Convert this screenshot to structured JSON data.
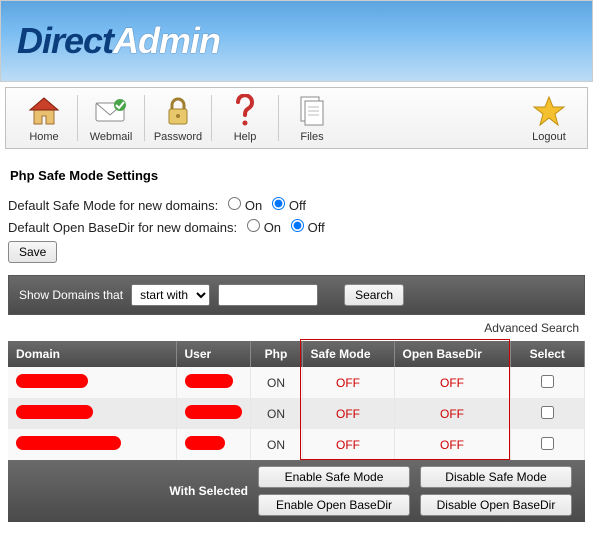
{
  "brand": {
    "part1": "Direct",
    "part2": "Admin"
  },
  "toolbar": [
    {
      "id": "home",
      "label": "Home"
    },
    {
      "id": "webmail",
      "label": "Webmail"
    },
    {
      "id": "password",
      "label": "Password"
    },
    {
      "id": "help",
      "label": "Help"
    },
    {
      "id": "files",
      "label": "Files"
    },
    {
      "id": "logout",
      "label": "Logout"
    }
  ],
  "page_title": "Php Safe Mode Settings",
  "settings": {
    "default_safe_label": "Default Safe Mode for new domains:",
    "default_basedir_label": "Default Open BaseDir for new domains:",
    "on": "On",
    "off": "Off",
    "safe_value": "off",
    "basedir_value": "off",
    "save": "Save"
  },
  "search": {
    "prefix": "Show Domains that",
    "mode": "start with",
    "modes": [
      "start with"
    ],
    "query": "",
    "button": "Search",
    "advanced": "Advanced Search"
  },
  "columns": {
    "domain": "Domain",
    "user": "User",
    "php": "Php",
    "safe": "Safe Mode",
    "basedir": "Open BaseDir",
    "select": "Select"
  },
  "rows": [
    {
      "php": "ON",
      "safe": "OFF",
      "basedir": "OFF"
    },
    {
      "php": "ON",
      "safe": "OFF",
      "basedir": "OFF"
    },
    {
      "php": "ON",
      "safe": "OFF",
      "basedir": "OFF"
    }
  ],
  "actions": {
    "with_selected": "With Selected",
    "enable_safe": "Enable Safe Mode",
    "disable_safe": "Disable Safe Mode",
    "enable_basedir": "Enable Open BaseDir",
    "disable_basedir": "Disable Open BaseDir"
  }
}
